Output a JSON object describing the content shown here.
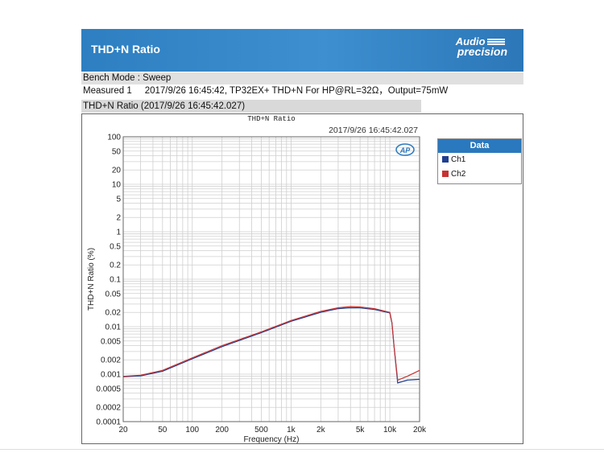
{
  "header": {
    "title": "THD+N Ratio",
    "logo_line1": "Audio",
    "logo_line2": "precision"
  },
  "bench_mode": "Bench Mode : Sweep",
  "measured": "Measured 1     2017/9/26 16:45:42, TP32EX+ THD+N For HP@RL=32Ω，Output=75mW",
  "section_title": "THD+N Ratio (2017/9/26 16:45:42.027)",
  "chart_data": {
    "type": "line",
    "title": "THD+N Ratio",
    "timestamp": "2017/9/26 16:45:42.027",
    "badge": "AP",
    "xlabel": "Frequency (Hz)",
    "ylabel": "THD+N Ratio (%)",
    "x_scale": "log",
    "y_scale": "log",
    "xlim": [
      20,
      20000
    ],
    "ylim": [
      0.0001,
      100
    ],
    "grid": true,
    "legend_title": "Data",
    "legend_position": "right",
    "x_ticks": [
      {
        "v": 20,
        "label": "20"
      },
      {
        "v": 50,
        "label": "50"
      },
      {
        "v": 100,
        "label": "100"
      },
      {
        "v": 200,
        "label": "200"
      },
      {
        "v": 500,
        "label": "500"
      },
      {
        "v": 1000,
        "label": "1k"
      },
      {
        "v": 2000,
        "label": "2k"
      },
      {
        "v": 5000,
        "label": "5k"
      },
      {
        "v": 10000,
        "label": "10k"
      },
      {
        "v": 20000,
        "label": "20k"
      }
    ],
    "y_ticks": [
      {
        "v": 100,
        "label": "100"
      },
      {
        "v": 50,
        "label": "50"
      },
      {
        "v": 20,
        "label": "20"
      },
      {
        "v": 10,
        "label": "10"
      },
      {
        "v": 5,
        "label": "5"
      },
      {
        "v": 2,
        "label": "2"
      },
      {
        "v": 1,
        "label": "1"
      },
      {
        "v": 0.5,
        "label": "0.5"
      },
      {
        "v": 0.2,
        "label": "0.2"
      },
      {
        "v": 0.1,
        "label": "0.1"
      },
      {
        "v": 0.05,
        "label": "0.05"
      },
      {
        "v": 0.02,
        "label": "0.02"
      },
      {
        "v": 0.01,
        "label": "0.01"
      },
      {
        "v": 0.005,
        "label": "0.005"
      },
      {
        "v": 0.002,
        "label": "0.002"
      },
      {
        "v": 0.001,
        "label": "0.001"
      },
      {
        "v": 0.0005,
        "label": "0.0005"
      },
      {
        "v": 0.0002,
        "label": "0.0002"
      },
      {
        "v": 0.0001,
        "label": "0.0001"
      }
    ],
    "series": [
      {
        "name": "Ch1",
        "color": "#1f3f8f",
        "points": [
          [
            20,
            0.00088
          ],
          [
            30,
            0.00092
          ],
          [
            50,
            0.00115
          ],
          [
            100,
            0.0021
          ],
          [
            200,
            0.0038
          ],
          [
            500,
            0.0075
          ],
          [
            1000,
            0.013
          ],
          [
            2000,
            0.02
          ],
          [
            3000,
            0.024
          ],
          [
            4000,
            0.025
          ],
          [
            5000,
            0.0248
          ],
          [
            7000,
            0.023
          ],
          [
            10000,
            0.0195
          ],
          [
            10500,
            0.012
          ],
          [
            11000,
            0.004
          ],
          [
            12000,
            0.00065
          ],
          [
            15000,
            0.00075
          ],
          [
            20000,
            0.00078
          ]
        ]
      },
      {
        "name": "Ch2",
        "color": "#c83232",
        "points": [
          [
            20,
            0.0009
          ],
          [
            30,
            0.00095
          ],
          [
            50,
            0.0012
          ],
          [
            100,
            0.0022
          ],
          [
            200,
            0.004
          ],
          [
            500,
            0.0078
          ],
          [
            1000,
            0.0135
          ],
          [
            2000,
            0.021
          ],
          [
            3000,
            0.025
          ],
          [
            4000,
            0.0265
          ],
          [
            5000,
            0.026
          ],
          [
            7000,
            0.024
          ],
          [
            10000,
            0.02
          ],
          [
            10500,
            0.012
          ],
          [
            11000,
            0.004
          ],
          [
            12000,
            0.00075
          ],
          [
            15000,
            0.0009
          ],
          [
            20000,
            0.0012
          ]
        ]
      }
    ]
  }
}
